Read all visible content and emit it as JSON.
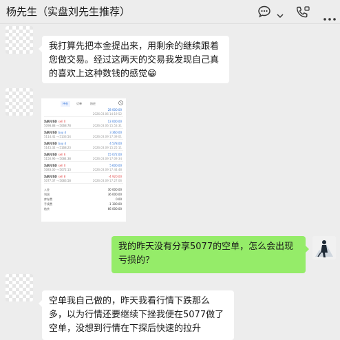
{
  "header": {
    "title": "杨先生（实盘刘先生推荐）"
  },
  "messages": {
    "m1": "我打算先把本金提出来，用剩余的继续跟着您做交易。经过这两天的交易我发现自己真的喜欢上这种数钱的感觉😁",
    "m2": "我的昨天没有分享5077的空单，怎么会出现亏损的？",
    "m3": "空单我自己做的，昨天我看行情下跌那么多，以为行情还要继续下挫我便在5077做了空单，没想到行情在下探后快速的拉升"
  },
  "screenshot": {
    "tabs": [
      "持仓",
      "订单",
      "历史"
    ],
    "total": "28 000.00",
    "total_time": "2026.03.06 14:19:52",
    "rows": [
      {
        "symbol": "XAUUSD",
        "side": "sell 0",
        "prices": "5098.88 → 5068.78",
        "amount": "13 000.00",
        "time": "2026.03.06 15:53:31"
      },
      {
        "symbol": "XAUUSD",
        "side": "buy 4",
        "prices": "5114.41 → 5133.54",
        "amount": "3 360.00",
        "time": "2026.03.09 17:39:01"
      },
      {
        "symbol": "XAUUSD",
        "side": "buy 4",
        "prices": "5145.32 → 5168.23",
        "amount": "4 578.00",
        "time": "2026.03.09 15:25:11"
      },
      {
        "symbol": "XAUUSD",
        "side": "sell 6",
        "prices": "5150.96 → 5084.38",
        "amount": "15 072.00",
        "time": "2026.03.09 17:09:34"
      },
      {
        "symbol": "XAUUSD",
        "side": "sell 0",
        "prices": "5083.00 → 5072.13",
        "amount": "5 600.00",
        "time": "2026.03.09 17:44:48"
      },
      {
        "symbol": "XAUUSD",
        "side": "sell 8",
        "prices": "5077.37 → 5083.58",
        "amount": "-4 920.00",
        "time": "2026.03.09 17:27:06"
      }
    ],
    "summary": [
      {
        "label": "入金",
        "value": "30 000.00"
      },
      {
        "label": "利润",
        "value": "36 000.00"
      },
      {
        "label": "库存费",
        "value": "0.00"
      },
      {
        "label": "手续费",
        "value": "-1 300.00"
      },
      {
        "label": "结余",
        "value": "66 000.00"
      }
    ]
  }
}
